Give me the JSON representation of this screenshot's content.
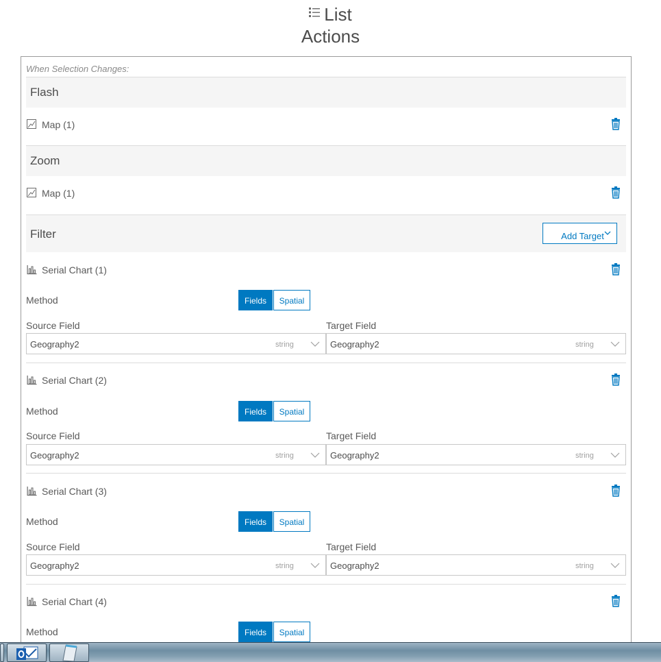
{
  "header": {
    "title_line1": "List",
    "title_line2": "Actions"
  },
  "panel": {
    "caption": "When Selection Changes:",
    "actions": [
      {
        "title": "Flash",
        "target": "Map (1)"
      },
      {
        "title": "Zoom",
        "target": "Map (1)"
      },
      {
        "title": "Filter",
        "add_target_label": "Add Target"
      }
    ],
    "filter_targets": [
      {
        "name": "Serial Chart (1)",
        "method_label": "Method",
        "method_options": [
          "Fields",
          "Spatial"
        ],
        "source_label": "Source Field",
        "target_label": "Target Field",
        "source_value": "Geography2",
        "source_type": "string",
        "target_value": "Geography2",
        "target_type": "string"
      },
      {
        "name": "Serial Chart (2)",
        "method_label": "Method",
        "method_options": [
          "Fields",
          "Spatial"
        ],
        "source_label": "Source Field",
        "target_label": "Target Field",
        "source_value": "Geography2",
        "source_type": "string",
        "target_value": "Geography2",
        "target_type": "string"
      },
      {
        "name": "Serial Chart (3)",
        "method_label": "Method",
        "method_options": [
          "Fields",
          "Spatial"
        ],
        "source_label": "Source Field",
        "target_label": "Target Field",
        "source_value": "Geography2",
        "source_type": "string",
        "target_value": "Geography2",
        "target_type": "string"
      },
      {
        "name": "Serial Chart (4)",
        "method_label": "Method",
        "method_options": [
          "Fields",
          "Spatial"
        ]
      }
    ]
  },
  "colors": {
    "accent": "#0079c1",
    "text": "#4c4c4c",
    "header_bg": "#f5f5f5"
  },
  "icons": [
    "list-icon",
    "map-icon",
    "chart-icon",
    "trash-icon",
    "chevron-down-icon",
    "outlook-icon"
  ]
}
